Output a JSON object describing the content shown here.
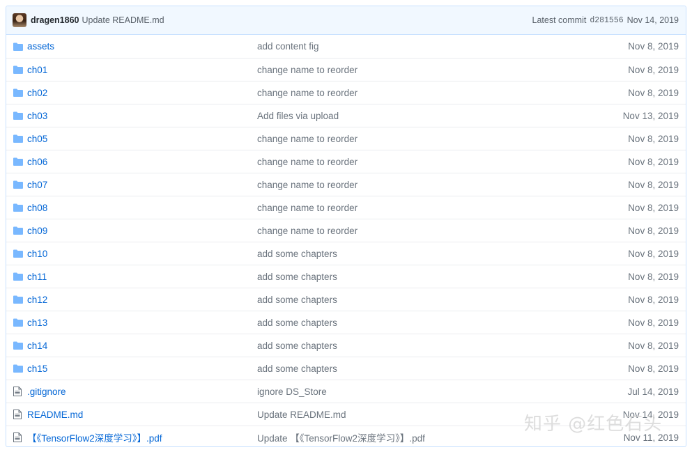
{
  "commit_header": {
    "author": "dragen1860",
    "message": "Update README.md",
    "latest_label": "Latest commit",
    "sha": "d281556",
    "date": "Nov 14, 2019"
  },
  "files": [
    {
      "type": "folder",
      "name": "assets",
      "message": "add content fig",
      "date": "Nov 8, 2019"
    },
    {
      "type": "folder",
      "name": "ch01",
      "message": "change name to reorder",
      "date": "Nov 8, 2019"
    },
    {
      "type": "folder",
      "name": "ch02",
      "message": "change name to reorder",
      "date": "Nov 8, 2019"
    },
    {
      "type": "folder",
      "name": "ch03",
      "message": "Add files via upload",
      "date": "Nov 13, 2019"
    },
    {
      "type": "folder",
      "name": "ch05",
      "message": "change name to reorder",
      "date": "Nov 8, 2019"
    },
    {
      "type": "folder",
      "name": "ch06",
      "message": "change name to reorder",
      "date": "Nov 8, 2019"
    },
    {
      "type": "folder",
      "name": "ch07",
      "message": "change name to reorder",
      "date": "Nov 8, 2019"
    },
    {
      "type": "folder",
      "name": "ch08",
      "message": "change name to reorder",
      "date": "Nov 8, 2019"
    },
    {
      "type": "folder",
      "name": "ch09",
      "message": "change name to reorder",
      "date": "Nov 8, 2019"
    },
    {
      "type": "folder",
      "name": "ch10",
      "message": "add some chapters",
      "date": "Nov 8, 2019"
    },
    {
      "type": "folder",
      "name": "ch11",
      "message": "add some chapters",
      "date": "Nov 8, 2019"
    },
    {
      "type": "folder",
      "name": "ch12",
      "message": "add some chapters",
      "date": "Nov 8, 2019"
    },
    {
      "type": "folder",
      "name": "ch13",
      "message": "add some chapters",
      "date": "Nov 8, 2019"
    },
    {
      "type": "folder",
      "name": "ch14",
      "message": "add some chapters",
      "date": "Nov 8, 2019"
    },
    {
      "type": "folder",
      "name": "ch15",
      "message": "add some chapters",
      "date": "Nov 8, 2019"
    },
    {
      "type": "file",
      "name": ".gitignore",
      "message": "ignore DS_Store",
      "date": "Jul 14, 2019"
    },
    {
      "type": "file",
      "name": "README.md",
      "message": "Update README.md",
      "date": "Nov 14, 2019"
    },
    {
      "type": "file",
      "name": "【《TensorFlow2深度学习》】.pdf",
      "message": "Update 【《TensorFlow2深度学习》】.pdf",
      "date": "Nov 11, 2019"
    }
  ],
  "icons": {
    "folder": "folder-icon",
    "file": "file-icon"
  },
  "colors": {
    "link": "#0366d6",
    "folder_icon": "#79b8ff",
    "header_bg": "#f1f8ff"
  },
  "watermark": "知乎 @红色石头"
}
